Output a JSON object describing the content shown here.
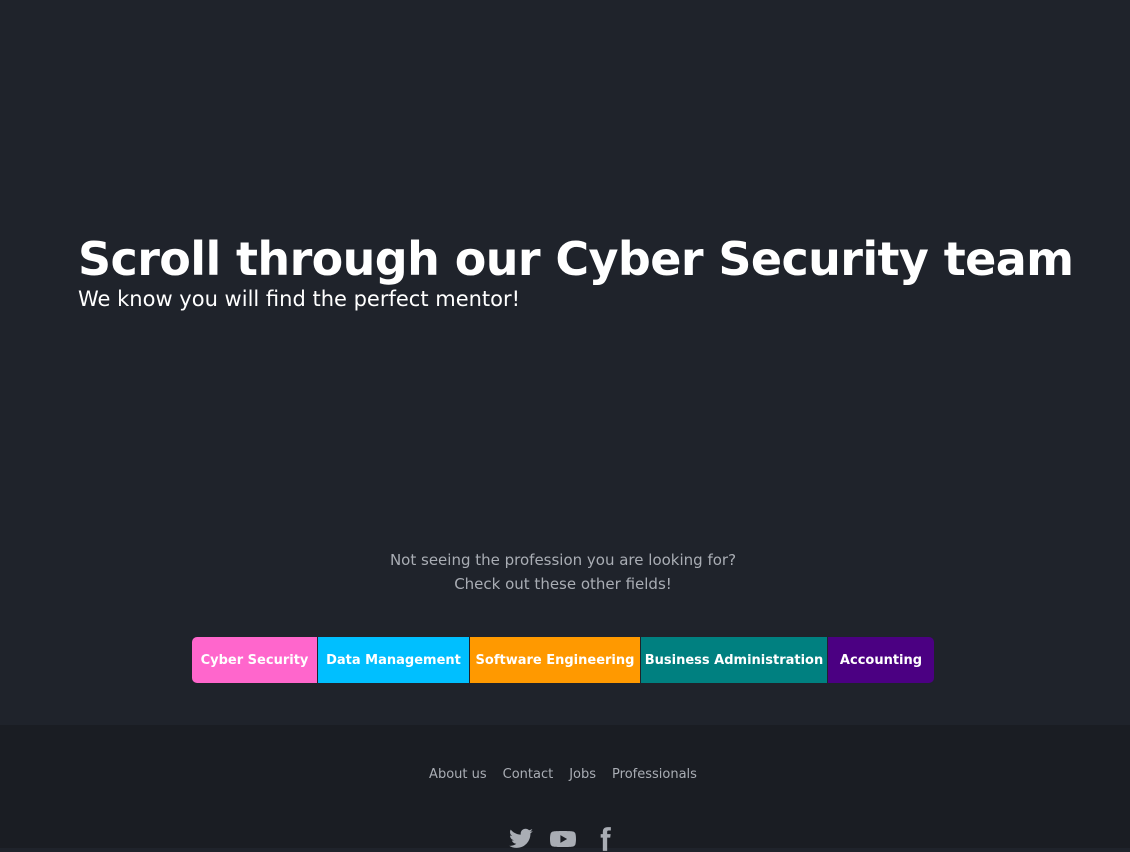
{
  "hero": {
    "title": "Scroll through our Cyber Security team",
    "subtitle": "We know you will find the perfect mentor!"
  },
  "other_fields": {
    "line1": "Not seeing the profession you are looking for?",
    "line2": "Check out these other fields!"
  },
  "fields": [
    {
      "label": "Cyber Security",
      "color": "#ff66cc"
    },
    {
      "label": "Data Management",
      "color": "#00bfff"
    },
    {
      "label": "Software Engineering",
      "color": "#ff9900"
    },
    {
      "label": "Business Administration",
      "color": "#008080"
    },
    {
      "label": "Accounting",
      "color": "#4b0082"
    }
  ],
  "footer": {
    "links": [
      "About us",
      "Contact",
      "Jobs",
      "Professionals"
    ],
    "social_icons": [
      "twitter-icon",
      "youtube-icon",
      "facebook-icon"
    ]
  },
  "colors": {
    "background": "#1f232b",
    "footer_background": "#1a1d23",
    "muted_text": "#a9adb4"
  }
}
